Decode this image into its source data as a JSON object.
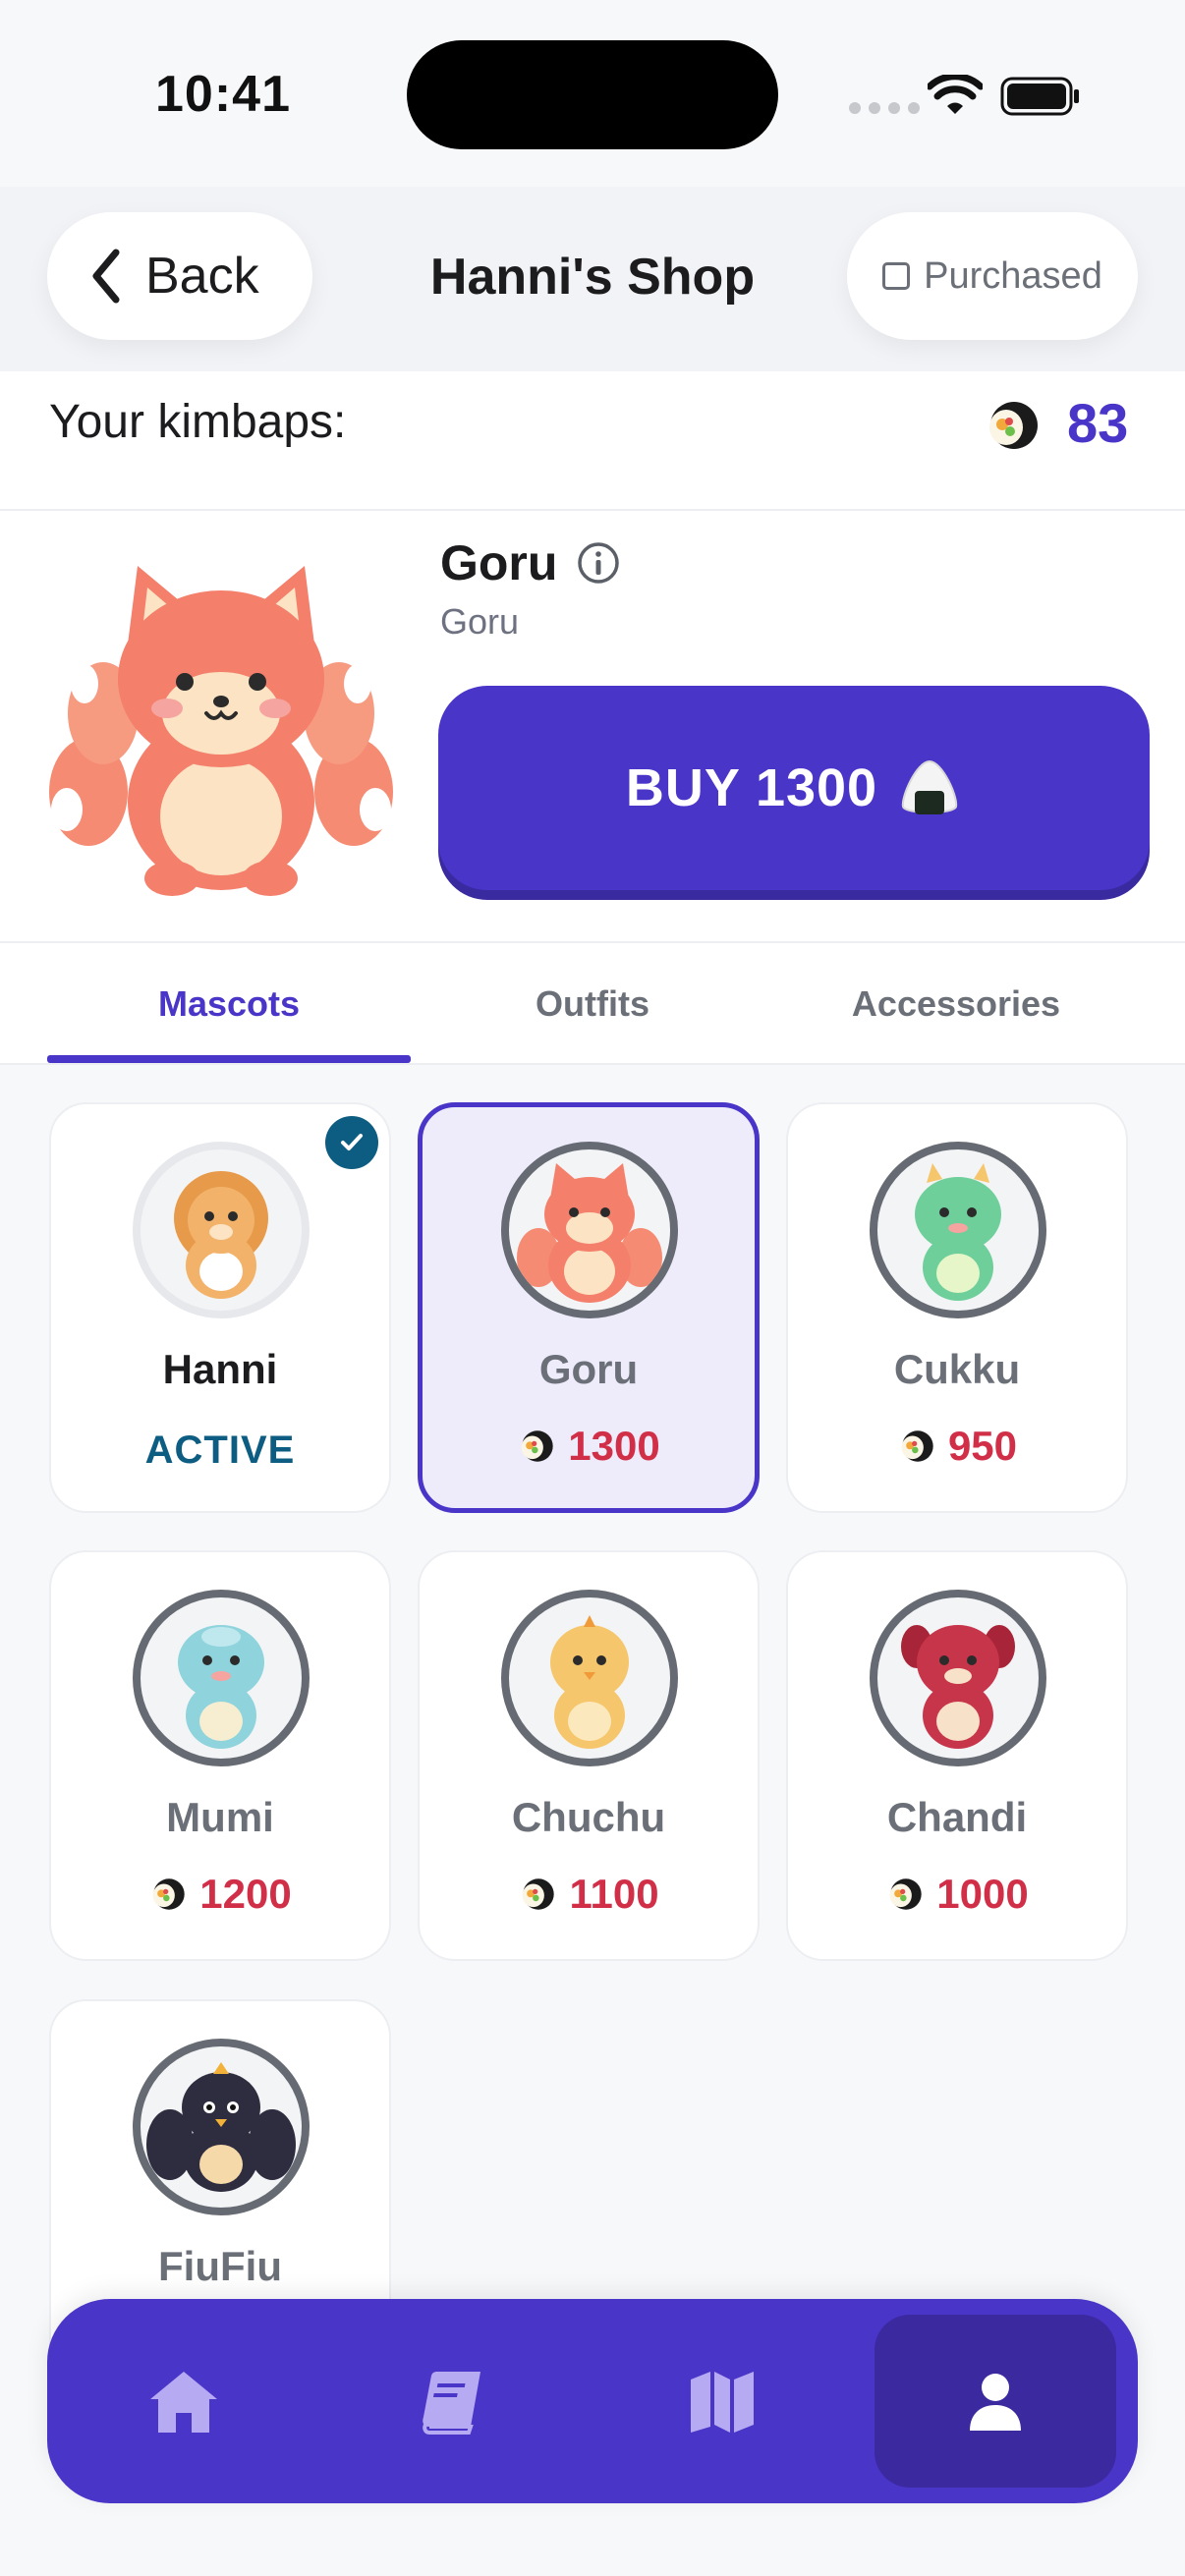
{
  "status_bar": {
    "time": "10:41"
  },
  "header": {
    "back_label": "Back",
    "title": "Hanni's Shop",
    "purchased_label": "Purchased"
  },
  "balance": {
    "label": "Your kimbaps:",
    "value": "83",
    "icon": "kimbap-icon"
  },
  "preview": {
    "name": "Goru",
    "subtitle": "Goru",
    "buy_label": "BUY 1300",
    "buy_icon": "onigiri-icon"
  },
  "tabs": [
    {
      "label": "Mascots",
      "active": true
    },
    {
      "label": "Outfits",
      "active": false
    },
    {
      "label": "Accessories",
      "active": false
    }
  ],
  "mascots": [
    {
      "name": "Hanni",
      "status": "ACTIVE",
      "owned": true,
      "color": "#f2b26a"
    },
    {
      "name": "Goru",
      "price": "1300",
      "selected": true,
      "color": "#f47f6b"
    },
    {
      "name": "Cukku",
      "price": "950",
      "color": "#6fcf9a"
    },
    {
      "name": "Mumi",
      "price": "1200",
      "color": "#8fd3dc"
    },
    {
      "name": "Chuchu",
      "price": "1100",
      "color": "#f5c66b"
    },
    {
      "name": "Chandi",
      "price": "1000",
      "color": "#c7354a"
    },
    {
      "name": "FiuFiu",
      "price": "",
      "color": "#2d2d3f"
    }
  ],
  "bottom_nav": [
    {
      "icon": "home-icon",
      "active": false
    },
    {
      "icon": "book-icon",
      "active": false
    },
    {
      "icon": "map-icon",
      "active": false
    },
    {
      "icon": "profile-icon",
      "active": true
    }
  ],
  "colors": {
    "primary": "#4a35c9",
    "price": "#d12e48",
    "active_status": "#0d5d82"
  }
}
